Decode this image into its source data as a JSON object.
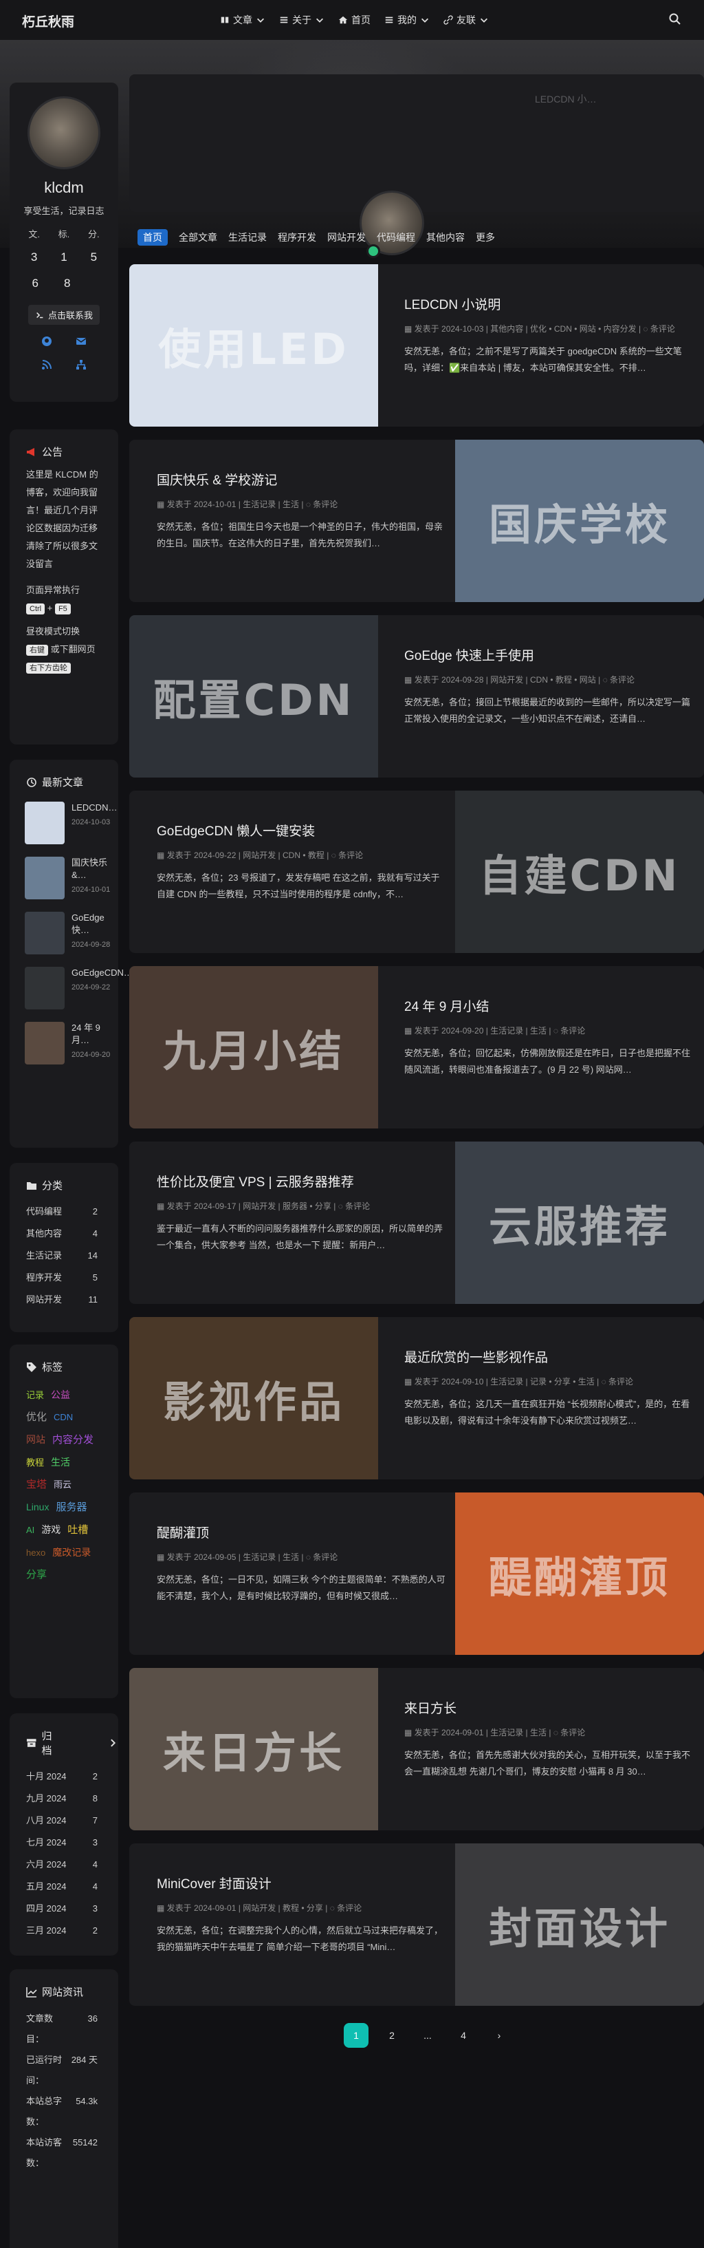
{
  "site": {
    "brand": "朽丘秋雨",
    "menu": [
      "文章",
      "关于",
      "首页",
      "我的",
      "友联"
    ]
  },
  "profile": {
    "name": "klcdm",
    "bio": "享受生活，记录日志",
    "stats_labels": [
      "文.",
      "标.",
      "分."
    ],
    "stats_row1": [
      "3",
      "1",
      "5"
    ],
    "stats_row2": [
      "6",
      "8",
      ""
    ],
    "button": "点击联系我"
  },
  "notice": {
    "title": "公告",
    "text": "这里是 KLCDM 的博客，欢迎向我留言！最近几个月评论区数据因为迁移清除了所以很多文没留言",
    "shortcut_label": "页面异常执行",
    "ctrl": "Ctrl",
    "f5": "F5",
    "dark_label": "昼夜模式切换",
    "dark_right": "右键",
    "dark_mid": "或下翻网页",
    "dark_bottom": "右下方齿轮"
  },
  "recent": {
    "title": "最新文章",
    "items": [
      {
        "title": "LEDCDN…",
        "date": "2024-10-03",
        "color": "#cfd8e6"
      },
      {
        "title": "国庆快乐 &…",
        "date": "2024-10-01",
        "color": "#6a7e94"
      },
      {
        "title": "GoEdge 快…",
        "date": "2024-09-28",
        "color": "#3a3f47"
      },
      {
        "title": "GoEdgeCDN…",
        "date": "2024-09-22",
        "color": "#303336"
      },
      {
        "title": "24 年 9 月…",
        "date": "2024-09-20",
        "color": "#5a4a40"
      }
    ]
  },
  "categories": {
    "title": "分类",
    "items": [
      {
        "name": "代码编程",
        "count": "2"
      },
      {
        "name": "其他内容",
        "count": "4"
      },
      {
        "name": "生活记录",
        "count": "14"
      },
      {
        "name": "程序开发",
        "count": "5"
      },
      {
        "name": "网站开发",
        "count": "11"
      }
    ]
  },
  "tags": {
    "title": "标签",
    "items": [
      {
        "name": "记录",
        "color": "#9bd13a"
      },
      {
        "name": "公益",
        "color": "#c74fc0"
      },
      {
        "name": "优化",
        "color": "#9c9c9c"
      },
      {
        "name": "CDN",
        "color": "#3d83d6"
      },
      {
        "name": "网站",
        "color": "#a04a3a"
      },
      {
        "name": "内容分发",
        "color": "#a24fd8"
      },
      {
        "name": "教程",
        "color": "#c9d43a"
      },
      {
        "name": "生活",
        "color": "#52d36a"
      },
      {
        "name": "宝塔",
        "color": "#b02a2a"
      },
      {
        "name": "雨云",
        "color": "#c9c4e0"
      },
      {
        "name": "Linux",
        "color": "#2ea86a"
      },
      {
        "name": "服务器",
        "color": "#5a9bd8"
      },
      {
        "name": "AI",
        "color": "#3bb25d"
      },
      {
        "name": "游戏",
        "color": "#d8d8d8"
      },
      {
        "name": "吐槽",
        "color": "#e0c23a"
      },
      {
        "name": "hexo",
        "color": "#8a5a2a"
      },
      {
        "name": "魔改记录",
        "color": "#c85a2a"
      },
      {
        "name": "分享",
        "color": "#2ea84a"
      }
    ]
  },
  "archive": {
    "title": "归档",
    "items": [
      {
        "name": "十月 2024",
        "count": "2"
      },
      {
        "name": "九月 2024",
        "count": "8"
      },
      {
        "name": "八月 2024",
        "count": "7"
      },
      {
        "name": "七月 2024",
        "count": "3"
      },
      {
        "name": "六月 2024",
        "count": "4"
      },
      {
        "name": "五月 2024",
        "count": "4"
      },
      {
        "name": "四月 2024",
        "count": "3"
      },
      {
        "name": "三月 2024",
        "count": "2"
      }
    ]
  },
  "siteinfo": {
    "title": "网站资讯",
    "rows": [
      {
        "k": "文章数目：",
        "v": "36"
      },
      {
        "k": "已运行时间：",
        "v": "284 天"
      },
      {
        "k": "本站总字数：",
        "v": "54.3k"
      },
      {
        "k": "本站访客数：",
        "v": "55142"
      }
    ]
  },
  "banner": {
    "sign": "LEDCDN 小…"
  },
  "cat_bar": [
    "首页",
    "全部文章",
    "生活记录",
    "程序开发",
    "网站开发",
    "代码编程",
    "其他内容",
    "更多"
  ],
  "posts": [
    {
      "title": "LEDCDN 小说明",
      "date": "2024-10-03",
      "cat": "其他内容",
      "tags": "优化 • CDN • 网站 • 内容分发",
      "comment": "条评论",
      "excerpt": "安然无恙，各位；之前不是写了两篇关于 goedgeCDN 系统的一些文笔吗，详细：✅来自本站 | 博友，本站可确保其安全性。不排…",
      "cover": "使用LED",
      "bg": "#d8e0ec"
    },
    {
      "title": "国庆快乐 & 学校游记",
      "date": "2024-10-01",
      "cat": "生活记录",
      "tags": "生活",
      "comment": "条评论",
      "excerpt": "安然无恙，各位；祖国生日今天也是一个神圣的日子，伟大的祖国，母亲的生日。国庆节。在这伟大的日子里，首先先祝贺我们…",
      "cover": "国庆学校",
      "bg": "#5d6f84"
    },
    {
      "title": "GoEdge 快速上手使用",
      "date": "2024-09-28",
      "cat": "网站开发",
      "tags": "CDN • 教程 • 网站",
      "comment": "条评论",
      "excerpt": "安然无恙，各位；接回上节根据最近的收到的一些邮件，所以决定写一篇正常投入使用的全记录文，一些小知识点不在阐述，还请自…",
      "cover": "配置CDN",
      "bg": "#2e3238"
    },
    {
      "title": "GoEdgeCDN 懒人一键安装",
      "date": "2024-09-22",
      "cat": "网站开发",
      "tags": "CDN • 教程",
      "comment": "条评论",
      "excerpt": "安然无恙，各位；23 号报道了，发发存稿吧 在这之前，我就有写过关于自建 CDN 的一些教程，只不过当时使用的程序是 cdnfly，不…",
      "cover": "自建CDN",
      "bg": "#2a2d30"
    },
    {
      "title": "24 年 9 月小结",
      "date": "2024-09-20",
      "cat": "生活记录",
      "tags": "生活",
      "comment": "条评论",
      "excerpt": "安然无恙，各位；回忆起来，仿佛刚放假还是在昨日，日子也是把握不住随风流逝，转眼间也准备报道去了。(9 月 22 号) 网站网…",
      "cover": "九月小结",
      "bg": "#4a3a32"
    },
    {
      "title": "性价比及便宜 VPS | 云服务器推荐",
      "date": "2024-09-17",
      "cat": "网站开发",
      "tags": "服务器 • 分享",
      "comment": "条评论",
      "excerpt": "鉴于最近一直有人不断的问问服务器推荐什么那家的原因，所以简单的弄一个集合，供大家参考 当然，也是水一下 提醒：新用户…",
      "cover": "云服推荐",
      "bg": "#3a4048"
    },
    {
      "title": "最近欣赏的一些影视作品",
      "date": "2024-09-10",
      "cat": "生活记录",
      "tags": "记录 • 分享 • 生活",
      "comment": "条评论",
      "excerpt": "安然无恙，各位；这几天一直在疯狂开始 “长视频耐心模式”，是的，在看电影以及剧，得说有过十余年没有静下心来欣赏过视频艺…",
      "cover": "影视作品",
      "bg": "#4a3828"
    },
    {
      "title": "醍醐灌顶",
      "date": "2024-09-05",
      "cat": "生活记录",
      "tags": "生活",
      "comment": "条评论",
      "excerpt": "安然无恙，各位；一日不见，如隔三秋 今个的主题很简单：不熟悉的人可能不清楚，我个人，是有时候比较浮躁的，但有时候又很成…",
      "cover": "醍醐灌顶",
      "bg": "#c85a2a"
    },
    {
      "title": "来日方长",
      "date": "2024-09-01",
      "cat": "生活记录",
      "tags": "生活",
      "comment": "条评论",
      "excerpt": "安然无恙，各位；首先先感谢大伙对我的关心，互相开玩笑，以至于我不会一直糊涂乱想 先谢几个哥们，博友的安慰 小猫再 8 月 30…",
      "cover": "来日方长",
      "bg": "#5a5048"
    },
    {
      "title": "MiniCover 封面设计",
      "date": "2024-09-01",
      "cat": "网站开发",
      "tags": "教程 • 分享",
      "comment": "条评论",
      "excerpt": "安然无恙，各位；在调整完我个人的心情，然后就立马过来把存稿发了，我的猫猫昨天中午去喵星了 简单介绍一下老哥的项目 “Mini…",
      "cover": "封面设计",
      "bg": "#3a3a3d"
    }
  ],
  "pagination": [
    "1",
    "2",
    "...",
    "4",
    "›"
  ]
}
